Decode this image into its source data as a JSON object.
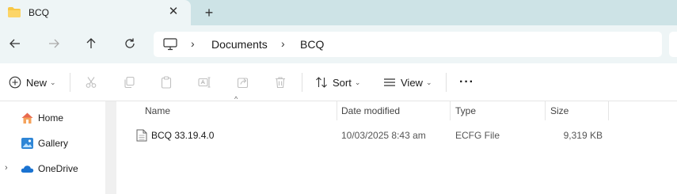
{
  "tab": {
    "title": "BCQ",
    "close": "✕",
    "new_tab": "+"
  },
  "nav": {
    "back": "back",
    "forward": "forward",
    "up": "up",
    "refresh": "refresh",
    "breadcrumb": [
      "Documents",
      "BCQ"
    ],
    "separator": "›"
  },
  "toolbar": {
    "new_label": "New",
    "sort_label": "Sort",
    "view_label": "View",
    "more": "···",
    "caret": "⌄"
  },
  "sidebar": {
    "items": [
      {
        "label": "Home",
        "icon": "home-icon"
      },
      {
        "label": "Gallery",
        "icon": "gallery-icon"
      },
      {
        "label": "OneDrive",
        "icon": "cloud-icon",
        "chevron": "›"
      }
    ]
  },
  "columns": [
    "Name",
    "Date modified",
    "Type",
    "Size"
  ],
  "sort_indicator": "^",
  "files": [
    {
      "name": "BCQ 33.19.4.0",
      "date": "10/03/2025 8:43 am",
      "type": "ECFG File",
      "size": "9,319 KB"
    }
  ],
  "colors": {
    "accent": "#0067c0",
    "tab_strip": "#cde3e6",
    "nav_bg": "#eef5f6"
  }
}
